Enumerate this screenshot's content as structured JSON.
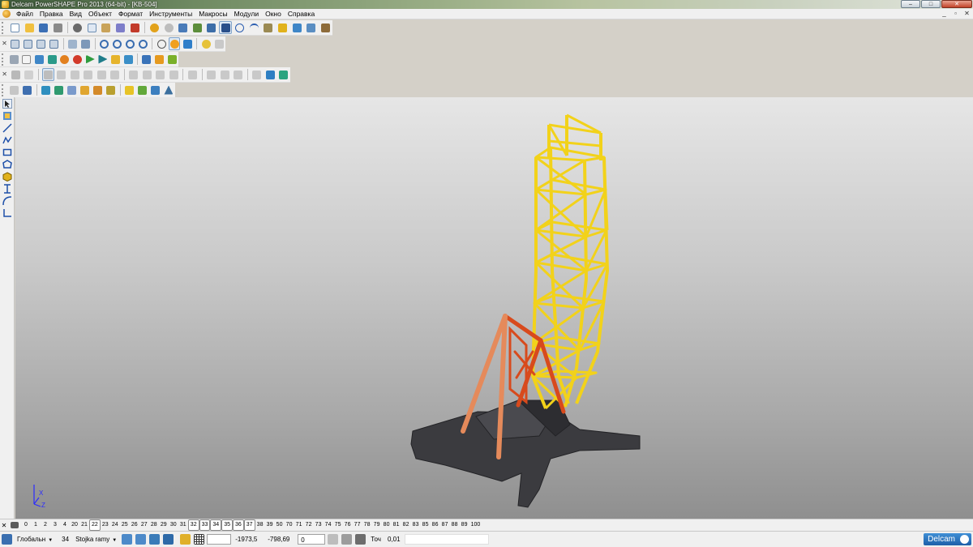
{
  "window": {
    "title": "Delcam PowerSHAPE Pro 2013 (64-bit) - [KB-504]",
    "controls": [
      "–",
      "□",
      "✕"
    ]
  },
  "menubar": {
    "items": [
      "Файл",
      "Правка",
      "Вид",
      "Объект",
      "Формат",
      "Инструменты",
      "Макросы",
      "Модули",
      "Окно",
      "Справка"
    ],
    "mdi_controls": [
      "_",
      "▫",
      "✕"
    ]
  },
  "toolbars": {
    "row1": [
      "new-icon",
      "open-icon",
      "save-icon",
      "print-icon",
      "cut-icon",
      "copy-icon",
      "paste-icon",
      "clipboard-icon",
      "magic-icon",
      "delete-icon",
      "undo-icon",
      "redo-icon",
      "text-icon",
      "selection-icon",
      "select-arrow-icon",
      "circle-icon",
      "curve-icon",
      "measure-icon",
      "snap-icon",
      "solid-icon",
      "surface-icon",
      "tools-icon"
    ],
    "row2": [
      "view-iso-icon",
      "view-front-icon",
      "view-side-icon",
      "view-top-icon",
      "zoom-in-icon",
      "zoom-out-icon",
      "zoom-box-icon",
      "zoom-all-icon",
      "rotate-icon",
      "shade-icon",
      "light-icon",
      "hand-icon"
    ],
    "row3": [
      "layers-icon",
      "levels-icon",
      "material-icon",
      "color-icon",
      "red-ball-icon",
      "play-icon",
      "play-outline-icon",
      "box-icon",
      "grid-icon",
      "solid-orange-icon",
      "info-icon",
      "arrow-icon"
    ],
    "row4": [
      "feature-icon",
      "blend-icon",
      "fillet-icon",
      "chamfer-icon",
      "shell-icon",
      "cut-solid-icon",
      "add-solid-icon",
      "subtract-icon",
      "intersect-icon",
      "split-icon",
      "mirror-icon",
      "scale-icon",
      "move-icon",
      "copy-solid-icon",
      "shaded-icon"
    ],
    "row5": [
      "wireframe-icon",
      "curve-fit-icon",
      "surface-blue-icon",
      "surface-green-icon",
      "point-cloud-icon",
      "mesh-icon",
      "assembly-icon",
      "align-icon",
      "yellow-solid-icon",
      "fillet-green-icon",
      "surface-shade-icon"
    ]
  },
  "left_toolbar": [
    "select-icon",
    "layers-blue-icon",
    "line-icon",
    "polyline-icon",
    "rectangle-icon",
    "polygon-icon",
    "solid-cube-icon",
    "i-beam-icon",
    "arc-icon",
    "corner-icon"
  ],
  "viewport": {
    "axes": {
      "x": "X",
      "z": "Z"
    },
    "colors": {
      "tower": "#f2d21a",
      "frame": "#d84a1c",
      "base": "#3b3b3f"
    }
  },
  "levels": {
    "numbers": [
      "0",
      "1",
      "2",
      "3",
      "4",
      "20",
      "21",
      "22",
      "23",
      "24",
      "25",
      "26",
      "27",
      "28",
      "29",
      "30",
      "31",
      "32",
      "33",
      "34",
      "35",
      "36",
      "37",
      "38",
      "39",
      "50",
      "70",
      "71",
      "72",
      "73",
      "74",
      "75",
      "76",
      "77",
      "78",
      "79",
      "80",
      "81",
      "82",
      "83",
      "85",
      "86",
      "87",
      "88",
      "89",
      "100"
    ],
    "boxed": [
      "22",
      "32",
      "33",
      "34",
      "35",
      "36",
      "37"
    ]
  },
  "status": {
    "workplane": "Глобальн",
    "level_number": "34",
    "level_name": "Stojka ramy",
    "x": "-1973,5",
    "y": "-798,69",
    "z": "0",
    "tolerance_label": "Точ",
    "tolerance": "0,01",
    "brand": "Delcam"
  }
}
